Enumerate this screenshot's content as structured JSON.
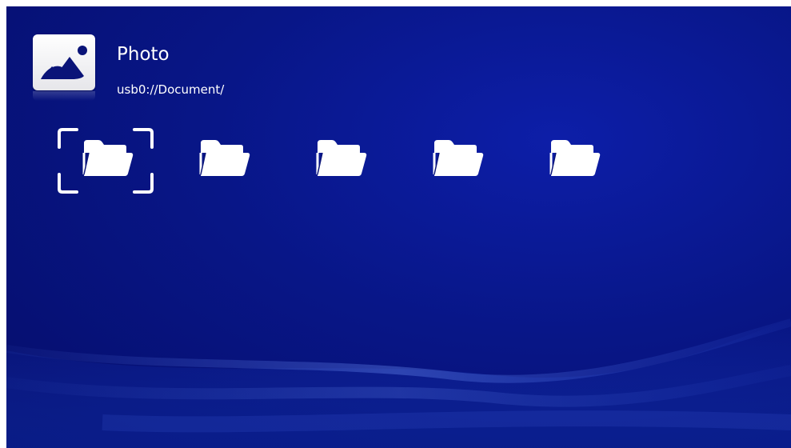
{
  "header": {
    "title": "Photo",
    "path": "usb0://Document/",
    "icon": "photo-app-icon"
  },
  "folders": [
    {
      "icon": "folder-icon",
      "selected": true
    },
    {
      "icon": "folder-icon",
      "selected": false
    },
    {
      "icon": "folder-icon",
      "selected": false
    },
    {
      "icon": "folder-icon",
      "selected": false
    },
    {
      "icon": "folder-icon",
      "selected": false
    }
  ],
  "colors": {
    "background": "#081687",
    "text": "#ffffff",
    "icon_dark": "#0a1478",
    "folder": "#ffffff"
  }
}
